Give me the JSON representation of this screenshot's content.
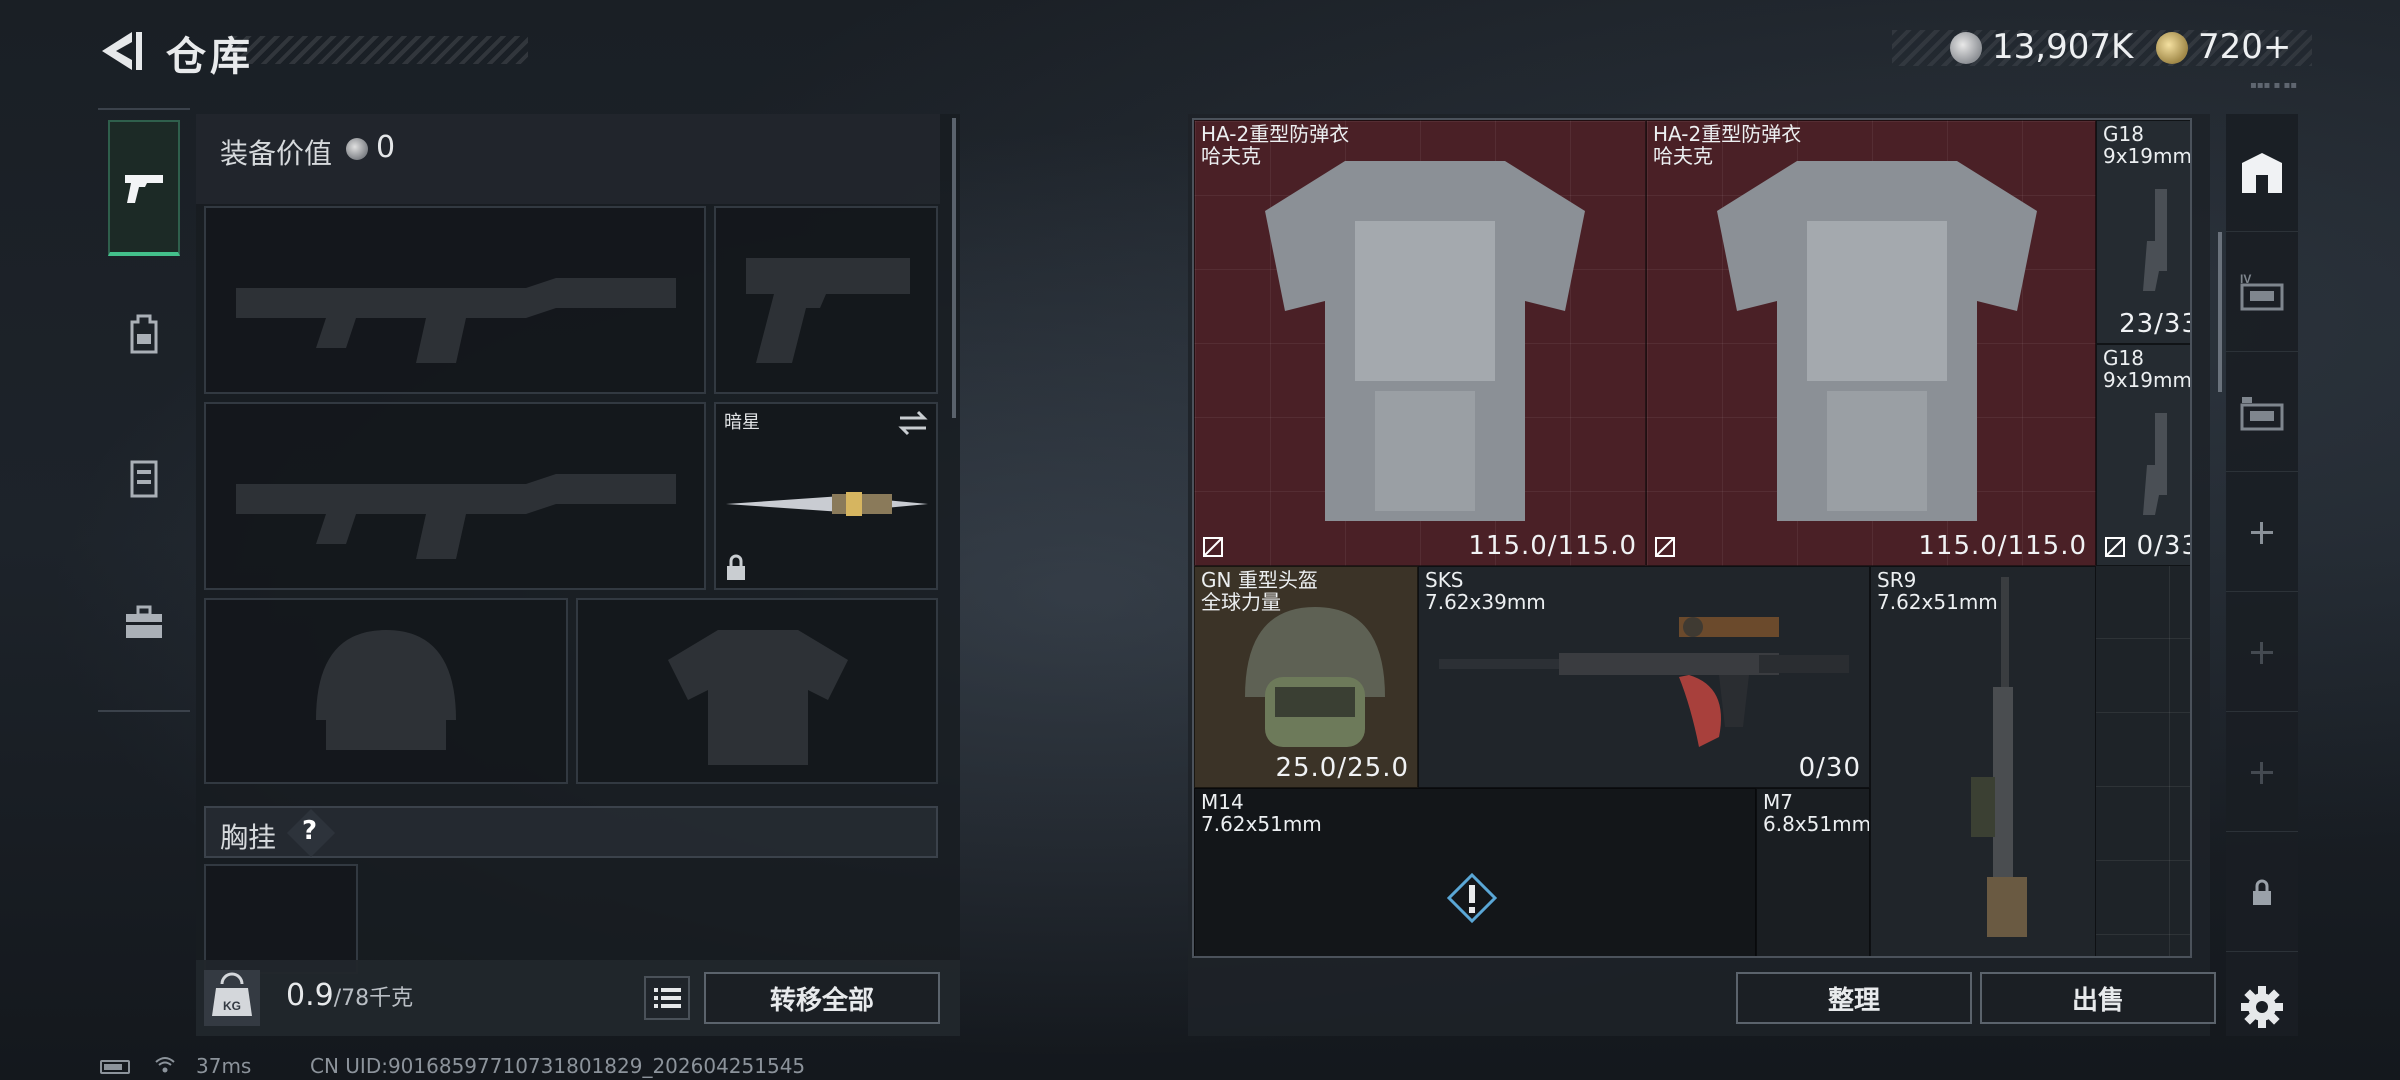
{
  "header": {
    "title": "仓库",
    "currency_silver": "13,907K",
    "currency_gold": "720+",
    "tiny_text": "▪▪▪ ▪ ▪▪"
  },
  "loadout": {
    "value_label": "装备价值",
    "value_amount": "0",
    "melee_name": "暗星",
    "chest_rig_label": "胸挂",
    "chest_rig_help": "?",
    "weight_current": "0.9",
    "weight_max": "/78千克",
    "weight_icon_text": "KG",
    "transfer_all_label": "转移全部"
  },
  "storage": {
    "items": {
      "armor_1": {
        "name": "HA-2重型防弹衣",
        "sub": "哈夫克",
        "value": "115.0/115.0"
      },
      "armor_2": {
        "name": "HA-2重型防弹衣",
        "sub": "哈夫克",
        "value": "115.0/115.0"
      },
      "g18_1": {
        "name": "G18",
        "sub": "9x19mm",
        "value": "23/33"
      },
      "g18_2": {
        "name": "G18",
        "sub": "9x19mm",
        "value": "0/33"
      },
      "helmet": {
        "name": "GN 重型头盔",
        "sub": "全球力量",
        "value": "25.0/25.0"
      },
      "sks": {
        "name": "SKS",
        "sub": "7.62x39mm",
        "value": "0/30"
      },
      "sr9": {
        "name": "SR9",
        "sub": "7.62x51mm"
      },
      "m14": {
        "name": "M14",
        "sub": "7.62x51mm"
      },
      "m7": {
        "name": "M7",
        "sub": "6.8x51mm"
      }
    },
    "sort_label": "整理",
    "sell_label": "出售"
  },
  "status_bar": {
    "ping": "37ms",
    "uid": "CN UID:9016859771073180182​9_202604251545"
  },
  "colors": {
    "accent_green": "#43c08b",
    "armor_bg": "#4a2026",
    "helmet_bg": "#3b3327"
  },
  "icons": {
    "back": "back-arrow-icon",
    "weapons": "pistol-icon",
    "backpack": "backpack-icon",
    "vest": "vest-icon",
    "case": "briefcase-icon",
    "stash": "stash-icon",
    "settings": "gear-icon",
    "lock": "lock-icon",
    "add": "plus-icon"
  }
}
